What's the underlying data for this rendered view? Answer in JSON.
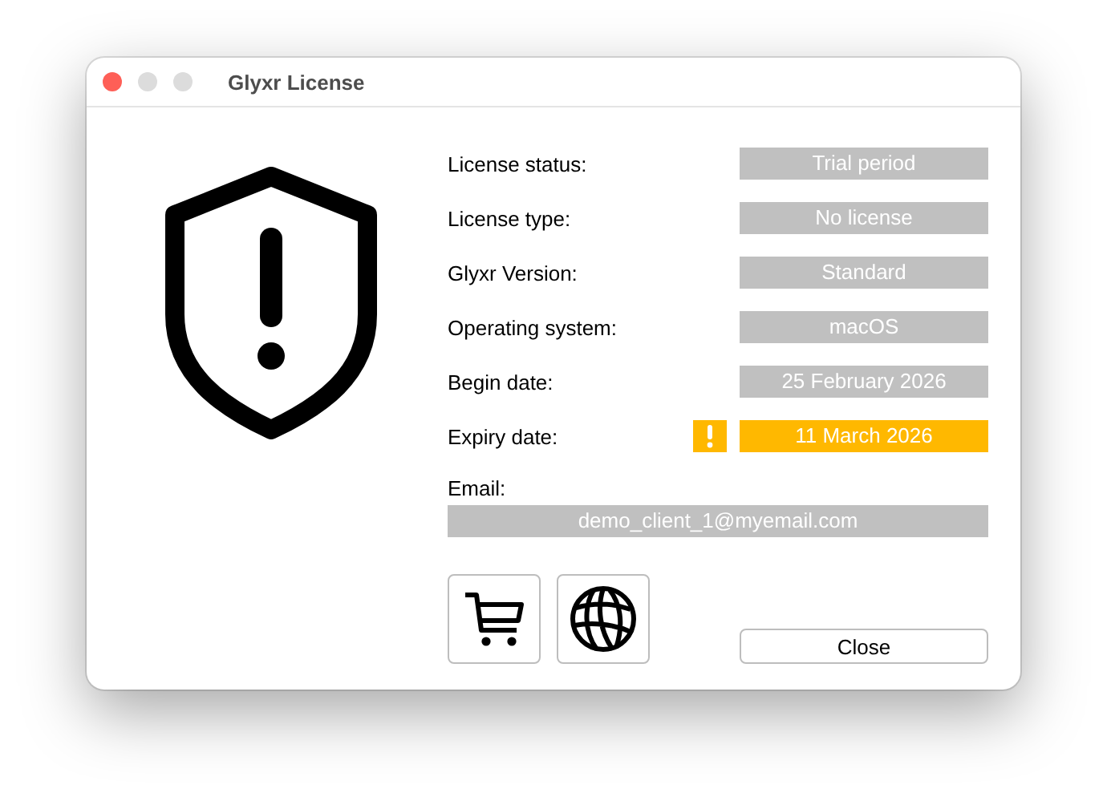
{
  "window": {
    "title": "Glyxr License"
  },
  "fields": [
    {
      "label": "License status:",
      "value": "Trial period",
      "warning": false
    },
    {
      "label": "License type:",
      "value": "No license",
      "warning": false
    },
    {
      "label": "Glyxr Version:",
      "value": "Standard",
      "warning": false
    },
    {
      "label": "Operating system:",
      "value": "macOS",
      "warning": false
    },
    {
      "label": "Begin date:",
      "value": "25 February 2026",
      "warning": false
    },
    {
      "label": "Expiry date:",
      "value": "11 March 2026",
      "warning": true
    }
  ],
  "email": {
    "label": "Email:",
    "value": "demo_client_1@myemail.com"
  },
  "buttons": [
    {
      "kind": "cart"
    },
    {
      "kind": "globe"
    },
    {
      "kind": "text",
      "label": "Close"
    }
  ]
}
